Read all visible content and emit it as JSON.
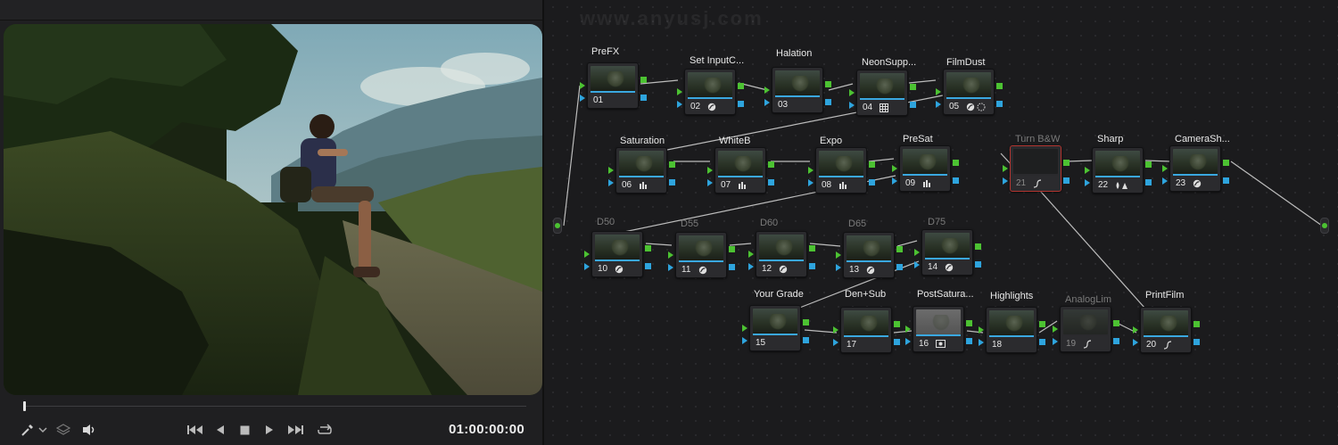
{
  "viewer": {
    "timecode": "01:00:00:00",
    "controls": [
      "eyedropper-icon",
      "chevron-down-icon",
      "layers-icon",
      "speaker-icon",
      "skip-to-start-icon",
      "play-reverse-icon",
      "stop-icon",
      "play-icon",
      "skip-to-end-icon",
      "loop-icon"
    ]
  },
  "watermark": "www.anyusj.com",
  "nodes": [
    {
      "id": "n01",
      "label": "PreFX",
      "number": "01",
      "icon": ""
    },
    {
      "id": "n02",
      "label": "Set InputC...",
      "number": "02",
      "icon": "curves-circle-icon"
    },
    {
      "id": "n03",
      "label": "Halation",
      "number": "03",
      "icon": ""
    },
    {
      "id": "n04",
      "label": "NeonSupp...",
      "number": "04",
      "icon": "grid-icon"
    },
    {
      "id": "n05",
      "label": "FilmDust",
      "number": "05",
      "icon": "fx-icons"
    },
    {
      "id": "n06",
      "label": "Saturation",
      "number": "06",
      "icon": "bars-icon"
    },
    {
      "id": "n07",
      "label": "WhiteB",
      "number": "07",
      "icon": "bars-icon"
    },
    {
      "id": "n08",
      "label": "Expo",
      "number": "08",
      "icon": "bars-icon"
    },
    {
      "id": "n09",
      "label": "PreSat",
      "number": "09",
      "icon": "bars-icon"
    },
    {
      "id": "n21",
      "label": "Turn B&W",
      "number": "21",
      "icon": "curve-icon"
    },
    {
      "id": "n22",
      "label": "Sharp",
      "number": "22",
      "icon": "blur-sharpen-icon"
    },
    {
      "id": "n23",
      "label": "CameraSh...",
      "number": "23",
      "icon": "curves-circle-icon"
    },
    {
      "id": "n10",
      "label": "D50",
      "number": "10",
      "icon": "curves-circle-icon"
    },
    {
      "id": "n11",
      "label": "D55",
      "number": "11",
      "icon": "curves-circle-icon"
    },
    {
      "id": "n12",
      "label": "D60",
      "number": "12",
      "icon": "curves-circle-icon"
    },
    {
      "id": "n13",
      "label": "D65",
      "number": "13",
      "icon": "curves-circle-icon"
    },
    {
      "id": "n14",
      "label": "D75",
      "number": "14",
      "icon": "curves-circle-icon"
    },
    {
      "id": "n15",
      "label": "Your Grade",
      "number": "15",
      "icon": ""
    },
    {
      "id": "n17",
      "label": "Den+Sub",
      "number": "17",
      "icon": ""
    },
    {
      "id": "n16",
      "label": "PostSatura...",
      "number": "16",
      "icon": "camera-icon"
    },
    {
      "id": "n18",
      "label": "Highlights",
      "number": "18",
      "icon": ""
    },
    {
      "id": "n19",
      "label": "AnalogLim",
      "number": "19",
      "icon": "curve-icon"
    },
    {
      "id": "n20",
      "label": "PrintFilm",
      "number": "20",
      "icon": "curve-icon"
    }
  ]
}
